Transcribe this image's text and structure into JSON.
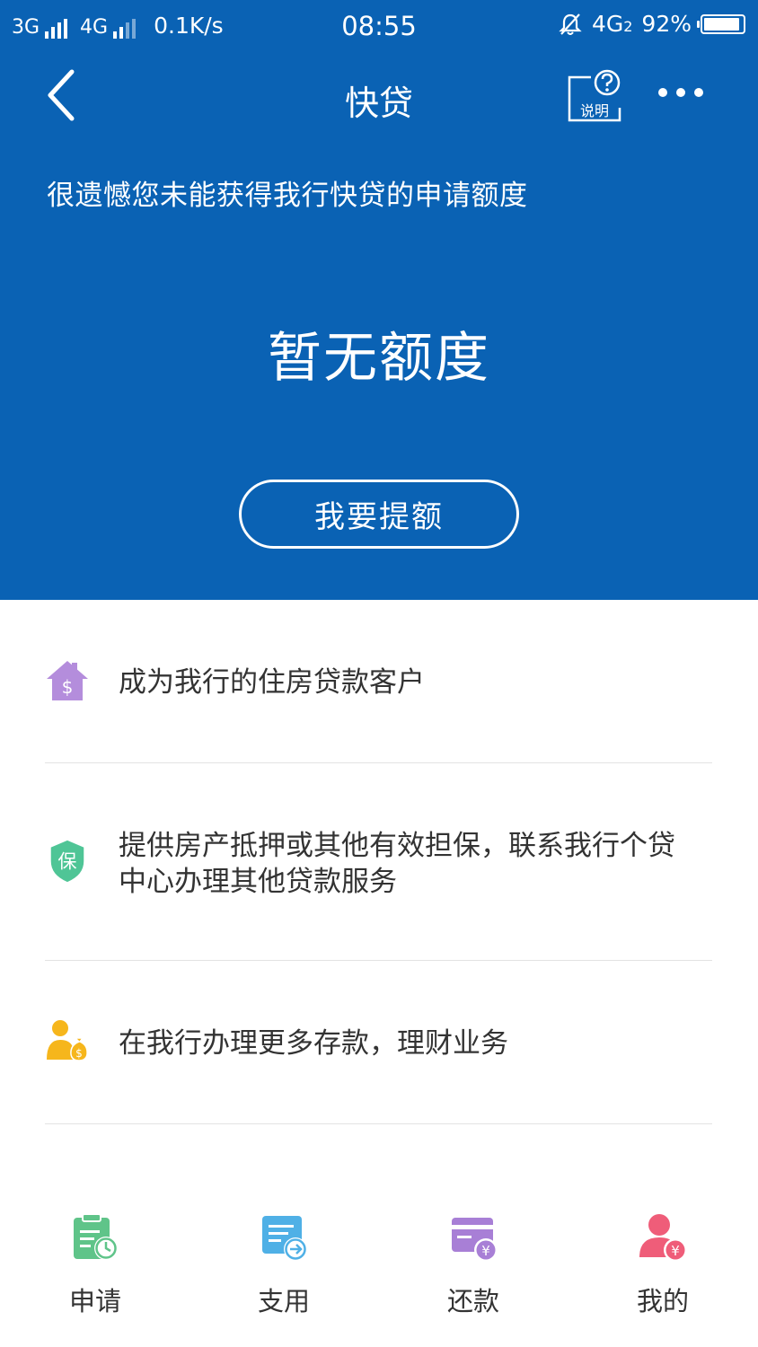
{
  "status_bar": {
    "network1": "3G",
    "network2": "4G",
    "speed": "0.1K/s",
    "time": "08:55",
    "network3": "4G",
    "network3_sub": "2",
    "battery": "92%"
  },
  "nav": {
    "title": "快贷",
    "help_label": "说明"
  },
  "hero": {
    "notice": "很遗憾您未能获得我行快贷的申请额度",
    "amount_text": "暂无额度",
    "raise_button": "我要提额"
  },
  "tips": [
    {
      "icon": "house-dollar-icon",
      "text": "成为我行的住房贷款客户"
    },
    {
      "icon": "shield-guarantee-icon",
      "icon_text": "保",
      "text": "提供房产抵押或其他有效担保，联系我行个贷中心办理其他贷款服务"
    },
    {
      "icon": "person-moneybag-icon",
      "text": "在我行办理更多存款，理财业务"
    }
  ],
  "tabs": [
    {
      "icon": "apply-clipboard-icon",
      "label": "申请"
    },
    {
      "icon": "withdraw-card-icon",
      "label": "支用"
    },
    {
      "icon": "repay-yuan-icon",
      "label": "还款"
    },
    {
      "icon": "my-profile-icon",
      "label": "我的"
    }
  ],
  "colors": {
    "primary_blue": "#0a62b4",
    "house_purple": "#b48ddc",
    "shield_green": "#4fc596",
    "person_yellow": "#f6b61c",
    "apply_green": "#5fc489",
    "withdraw_blue": "#4fb0e6",
    "repay_purple": "#a87fd6",
    "my_red": "#ef5d79"
  }
}
